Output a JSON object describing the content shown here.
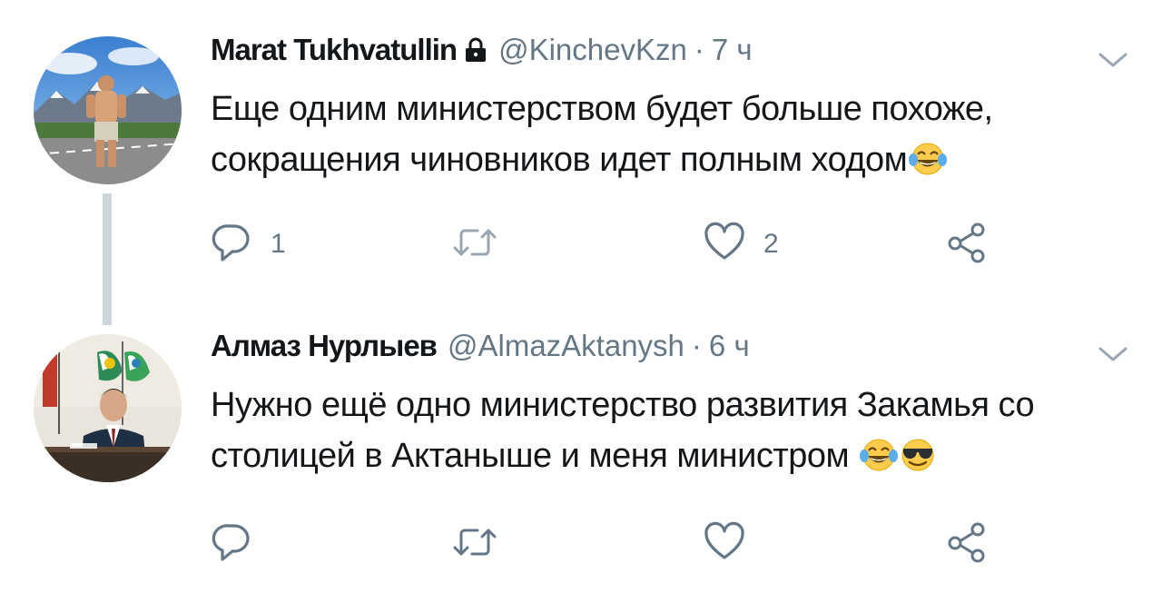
{
  "tweets": [
    {
      "author_name": "Marat Tukhvatullin",
      "protected": true,
      "handle": "@KinchevKzn",
      "separator": "·",
      "time": "7 ч",
      "text_line1": "Еще одним министерством будет больше похоже,",
      "text_line2": "сокращения чиновников идет полным ходом",
      "emojis": [
        "face-with-tears-of-joy"
      ],
      "reply_count": "1",
      "retweet_count": "",
      "like_count": "2"
    },
    {
      "author_name": "Алмаз Нурлыев",
      "protected": false,
      "handle": "@AlmazAktanysh",
      "separator": "·",
      "time": "6 ч",
      "text_line1": "Нужно ещё одно министерство развития Закамья со",
      "text_line2": "столицей в Актаныше и меня министром",
      "emojis": [
        "face-with-tears-of-joy",
        "smiling-face-with-sunglasses"
      ],
      "reply_count": "",
      "retweet_count": "",
      "like_count": ""
    }
  ],
  "colors": {
    "text_primary": "#14171a",
    "text_secondary": "#657786",
    "icon": "#657786",
    "thread_line": "#ccd6dd",
    "emoji_yellow": "#ffcc4d",
    "emoji_tears": "#5dadec"
  }
}
